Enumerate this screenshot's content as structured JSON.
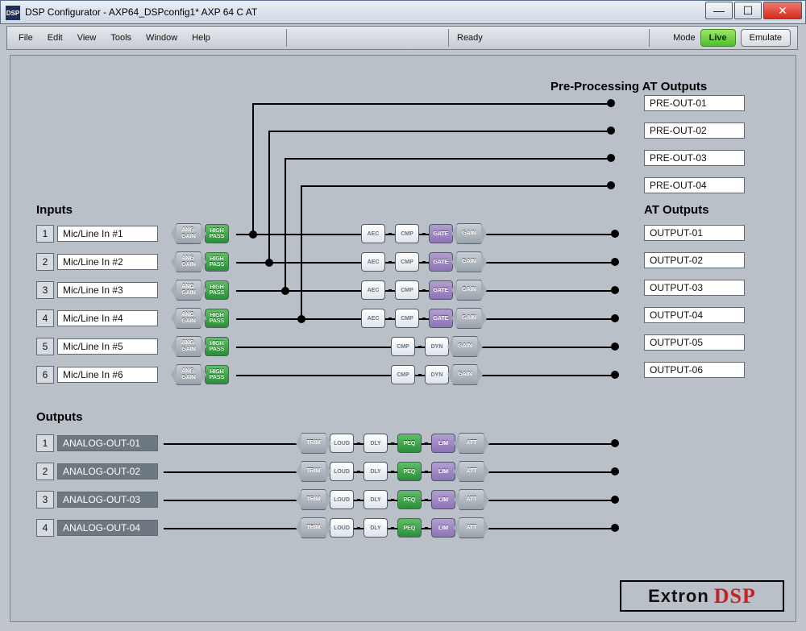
{
  "window": {
    "title": "DSP Configurator - AXP64_DSPconfig1*  AXP 64 C AT",
    "appicon": "DSP"
  },
  "menu": {
    "file": "File",
    "edit": "Edit",
    "view": "View",
    "tools": "Tools",
    "window": "Window",
    "help": "Help"
  },
  "status": {
    "ready": "Ready"
  },
  "mode": {
    "label": "Mode",
    "live": "Live",
    "emulate": "Emulate"
  },
  "section": {
    "inputs": "Inputs",
    "outputs": "Outputs",
    "preout": "Pre-Processing AT Outputs",
    "atout": "AT Outputs"
  },
  "inputs": [
    {
      "n": "1",
      "name": "Mic/Line In #1"
    },
    {
      "n": "2",
      "name": "Mic/Line In #2"
    },
    {
      "n": "3",
      "name": "Mic/Line In #3"
    },
    {
      "n": "4",
      "name": "Mic/Line In #4"
    },
    {
      "n": "5",
      "name": "Mic/Line In #5"
    },
    {
      "n": "6",
      "name": "Mic/Line In #6"
    }
  ],
  "outputs": [
    {
      "n": "1",
      "name": "ANALOG-OUT-01"
    },
    {
      "n": "2",
      "name": "ANALOG-OUT-02"
    },
    {
      "n": "3",
      "name": "ANALOG-OUT-03"
    },
    {
      "n": "4",
      "name": "ANALOG-OUT-04"
    }
  ],
  "preouts": [
    "PRE-OUT-01",
    "PRE-OUT-02",
    "PRE-OUT-03",
    "PRE-OUT-04"
  ],
  "atouts": [
    "OUTPUT-01",
    "OUTPUT-02",
    "OUTPUT-03",
    "OUTPUT-04",
    "OUTPUT-05",
    "OUTPUT-06"
  ],
  "blocks": {
    "ang_gain": "ANG\nGAIN",
    "high_pass": "HIGH\nPASS",
    "aec": "AEC",
    "cmp": "CMP",
    "gate": "GATE",
    "gain": "GAIN",
    "dyn": "DYN",
    "trim": "TRIM",
    "loud": "LOUD",
    "dly": "DLY",
    "peq": "PEQ",
    "lim": "LIM",
    "att": "ATT"
  },
  "brand": {
    "extron": "Extron",
    "dsp": "DSP"
  }
}
